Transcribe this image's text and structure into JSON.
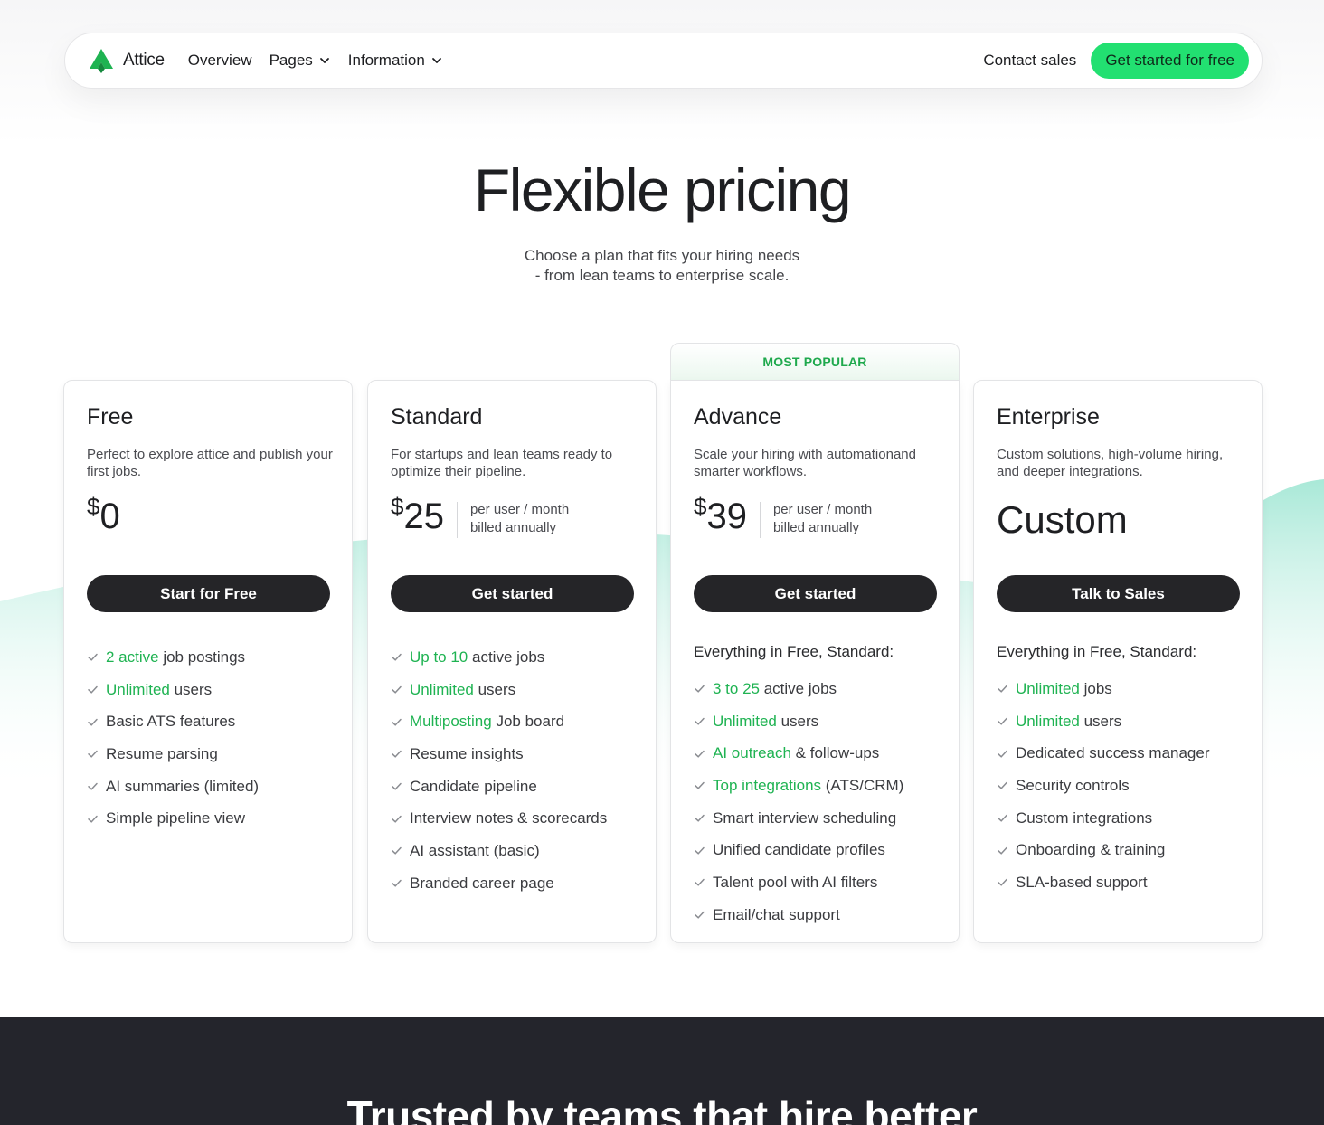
{
  "nav": {
    "brand": "Attice",
    "links": [
      {
        "label": "Overview",
        "dropdown": false
      },
      {
        "label": "Pages",
        "dropdown": true
      },
      {
        "label": "Information",
        "dropdown": true
      }
    ],
    "contact": "Contact sales",
    "cta": "Get started for free"
  },
  "hero": {
    "title": "Flexible pricing",
    "subtitle_line1": "Choose a plan that fits your hiring needs",
    "subtitle_line2": "- from lean teams to enterprise scale."
  },
  "popular_badge": "MOST POPULAR",
  "plans": [
    {
      "name": "Free",
      "description": "Perfect to explore attice and publish your first jobs.",
      "currency": "$",
      "amount": "0",
      "note_line1": "",
      "note_line2": "",
      "button": "Start for Free",
      "intro": "",
      "features": [
        {
          "hl": "2 active",
          "rest": " job postings"
        },
        {
          "hl": "Unlimited",
          "rest": " users"
        },
        {
          "hl": "",
          "rest": "Basic ATS features"
        },
        {
          "hl": "",
          "rest": "Resume parsing"
        },
        {
          "hl": "",
          "rest": "AI summaries (limited)"
        },
        {
          "hl": "",
          "rest": "Simple pipeline view"
        }
      ]
    },
    {
      "name": "Standard",
      "description": "For startups and lean teams ready to optimize their pipeline.",
      "currency": "$",
      "amount": "25",
      "note_line1": "per user / month",
      "note_line2": "billed annually",
      "button": "Get started",
      "intro": "",
      "features": [
        {
          "hl": "Up to 10",
          "rest": " active jobs"
        },
        {
          "hl": "Unlimited",
          "rest": " users"
        },
        {
          "hl": "Multiposting",
          "rest": " Job board"
        },
        {
          "hl": "",
          "rest": "Resume insights"
        },
        {
          "hl": "",
          "rest": "Candidate pipeline"
        },
        {
          "hl": "",
          "rest": "Interview notes & scorecards"
        },
        {
          "hl": "",
          "rest": "AI assistant (basic)"
        },
        {
          "hl": "",
          "rest": "Branded career page"
        }
      ]
    },
    {
      "name": "Advance",
      "description": "Scale your hiring with automationand smarter workflows.",
      "currency": "$",
      "amount": "39",
      "note_line1": "per user / month",
      "note_line2": "billed annually",
      "button": "Get started",
      "intro": "Everything in Free, Standard:",
      "features": [
        {
          "hl": "3 to 25",
          "rest": " active jobs"
        },
        {
          "hl": "Unlimited",
          "rest": " users"
        },
        {
          "hl": "AI outreach",
          "rest": " & follow-ups"
        },
        {
          "hl": "Top integrations",
          "rest": " (ATS/CRM)"
        },
        {
          "hl": "",
          "rest": "Smart interview scheduling"
        },
        {
          "hl": "",
          "rest": "Unified candidate profiles"
        },
        {
          "hl": "",
          "rest": "Talent pool with AI filters"
        },
        {
          "hl": "",
          "rest": "Email/chat support"
        }
      ]
    },
    {
      "name": "Enterprise",
      "description": "Custom solutions, high-volume hiring, and deeper integrations.",
      "custom_price": "Custom",
      "button": "Talk to Sales",
      "intro": "Everything in Free, Standard:",
      "features": [
        {
          "hl": "Unlimited",
          "rest": " jobs"
        },
        {
          "hl": "Unlimited",
          "rest": " users"
        },
        {
          "hl": "",
          "rest": "Dedicated success manager"
        },
        {
          "hl": "",
          "rest": "Security controls"
        },
        {
          "hl": "",
          "rest": "Custom integrations"
        },
        {
          "hl": "",
          "rest": "Onboarding & training"
        },
        {
          "hl": "",
          "rest": "SLA-based support"
        }
      ]
    }
  ],
  "trusted": {
    "title": "Trusted by teams that hire better"
  },
  "colors": {
    "accent": "#22e071",
    "highlight_text": "#1fb352",
    "dark_button": "#252528",
    "dark_band": "#24252c"
  },
  "icons": {
    "brand": "attice-logo-icon",
    "dropdown": "chevron-down-icon",
    "feature": "check-icon"
  }
}
